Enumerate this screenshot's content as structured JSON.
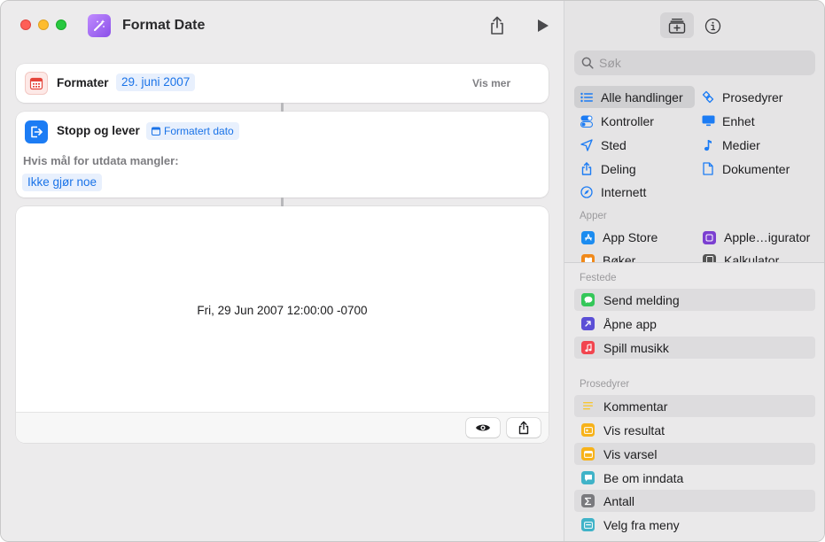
{
  "window": {
    "title": "Format Date"
  },
  "editor": {
    "format_action": {
      "label": "Formater",
      "date_token": "29. juni 2007",
      "more": "Vis mer"
    },
    "stop_action": {
      "label": "Stopp og lever",
      "token": "Formatert dato",
      "missing_label": "Hvis mål for utdata mangler:",
      "missing_value": "Ikke gjør noe"
    },
    "result": {
      "text": "Fri, 29 Jun 2007 12:00:00 -0700"
    }
  },
  "library": {
    "search_placeholder": "Søk",
    "categories_left": [
      {
        "label": "Alle handlinger",
        "icon": "list-icon",
        "color": "#1c7cf4",
        "selected": true
      },
      {
        "label": "Kontroller",
        "icon": "toggle-icon",
        "color": "#1c7cf4"
      },
      {
        "label": "Sted",
        "icon": "location-icon",
        "color": "#1c7cf4"
      },
      {
        "label": "Deling",
        "icon": "share-icon",
        "color": "#1c7cf4"
      },
      {
        "label": "Internett",
        "icon": "compass-icon",
        "color": "#1c7cf4"
      }
    ],
    "categories_right": [
      {
        "label": "Prosedyrer",
        "icon": "scripting-icon",
        "color": "#1c7cf4"
      },
      {
        "label": "Enhet",
        "icon": "monitor-icon",
        "color": "#1c7cf4"
      },
      {
        "label": "Medier",
        "icon": "music-note-icon",
        "color": "#1c7cf4"
      },
      {
        "label": "Dokumenter",
        "icon": "document-icon",
        "color": "#1c7cf4"
      }
    ],
    "apps_header": "Apper",
    "apps": [
      {
        "label": "App Store",
        "icon": "app-store-icon",
        "color": "#1c8cf0"
      },
      {
        "label": "Apple…igurator",
        "icon": "configurator-icon",
        "color": "#7b3fd1"
      },
      {
        "label": "Bøker",
        "icon": "books-icon",
        "color": "#f0891a"
      },
      {
        "label": "Kalkulator",
        "icon": "calculator-icon",
        "color": "#555555"
      }
    ],
    "pinned_header": "Festede",
    "pinned": [
      {
        "label": "Send melding",
        "icon": "message-icon",
        "color": "#34c759"
      },
      {
        "label": "Åpne app",
        "icon": "open-app-icon",
        "color": "#5b4fd6"
      },
      {
        "label": "Spill musikk",
        "icon": "music-icon",
        "color": "#f2454f"
      }
    ],
    "scripting_header": "Prosedyrer",
    "scripting": [
      {
        "label": "Kommentar",
        "icon": "comment-icon",
        "color": "#f7c631"
      },
      {
        "label": "Vis resultat",
        "icon": "show-result-icon",
        "color": "#f7b21a"
      },
      {
        "label": "Vis varsel",
        "icon": "alert-icon",
        "color": "#f7b21a"
      },
      {
        "label": "Be om inndata",
        "icon": "ask-input-icon",
        "color": "#40b3c8"
      },
      {
        "label": "Antall",
        "icon": "count-icon",
        "color": "#7a7a7e"
      },
      {
        "label": "Velg fra meny",
        "icon": "menu-icon",
        "color": "#40b3c8"
      }
    ]
  }
}
